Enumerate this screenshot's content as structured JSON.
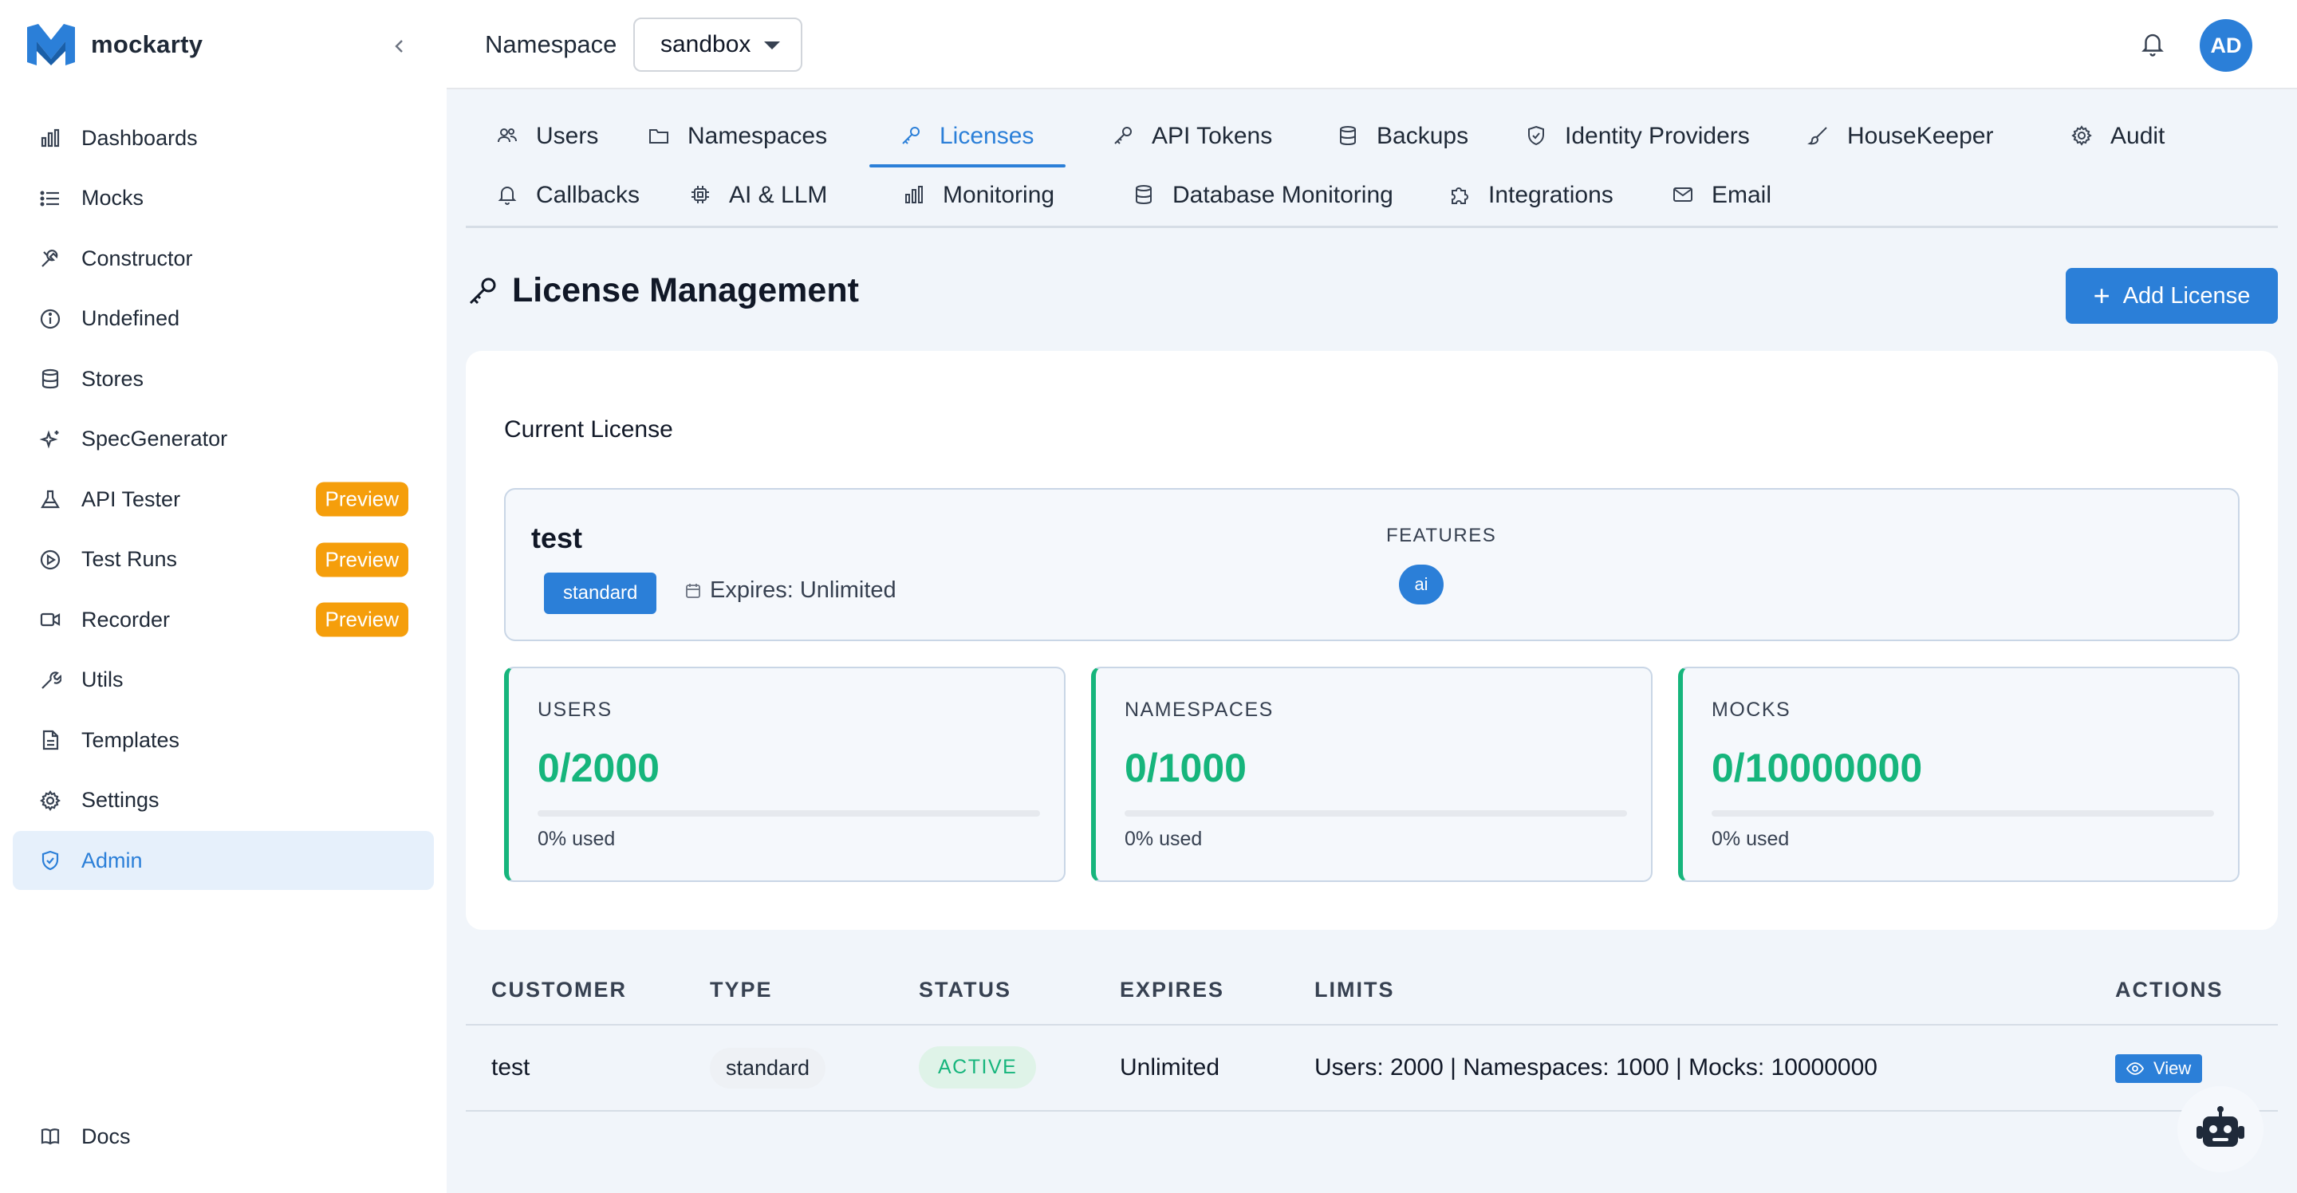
{
  "app": {
    "name": "mockarty",
    "brand_color": "#2b7fd8",
    "accent_green": "#16b57c",
    "preview_color": "#f59e0b"
  },
  "sidebar": {
    "items": [
      {
        "label": "Dashboards",
        "icon": "bar-chart-icon"
      },
      {
        "label": "Mocks",
        "icon": "list-icon"
      },
      {
        "label": "Constructor",
        "icon": "tools-icon"
      },
      {
        "label": "Undefined",
        "icon": "info-icon"
      },
      {
        "label": "Stores",
        "icon": "database-icon"
      },
      {
        "label": "SpecGenerator",
        "icon": "sparkles-icon"
      },
      {
        "label": "API Tester",
        "icon": "flask-icon",
        "badge": "Preview"
      },
      {
        "label": "Test Runs",
        "icon": "play-circle-icon",
        "badge": "Preview"
      },
      {
        "label": "Recorder",
        "icon": "video-icon",
        "badge": "Preview"
      },
      {
        "label": "Utils",
        "icon": "wrench-icon"
      },
      {
        "label": "Templates",
        "icon": "file-icon"
      },
      {
        "label": "Settings",
        "icon": "gear-icon"
      },
      {
        "label": "Admin",
        "icon": "shield-icon",
        "active": true
      }
    ],
    "docs_label": "Docs"
  },
  "header": {
    "namespace_label": "Namespace",
    "namespace_value": "sandbox",
    "avatar_initials": "AD"
  },
  "tabs": [
    {
      "label": "Users",
      "icon": "users-icon"
    },
    {
      "label": "Namespaces",
      "icon": "folder-icon"
    },
    {
      "label": "Licenses",
      "icon": "key-icon",
      "active": true
    },
    {
      "label": "API Tokens",
      "icon": "key-icon"
    },
    {
      "label": "Backups",
      "icon": "database-icon"
    },
    {
      "label": "Identity Providers",
      "icon": "shield-icon"
    },
    {
      "label": "HouseKeeper",
      "icon": "brush-icon"
    },
    {
      "label": "Audit",
      "icon": "gear-icon"
    },
    {
      "label": "Callbacks",
      "icon": "bell-icon"
    },
    {
      "label": "AI & LLM",
      "icon": "cpu-icon"
    },
    {
      "label": "Monitoring",
      "icon": "bar-chart-icon"
    },
    {
      "label": "Database Monitoring",
      "icon": "database-icon"
    },
    {
      "label": "Integrations",
      "icon": "puzzle-icon"
    },
    {
      "label": "Email",
      "icon": "mail-icon"
    }
  ],
  "page": {
    "title": "License Management",
    "add_button": "Add License"
  },
  "current_license": {
    "section_title": "Current License",
    "name": "test",
    "type": "standard",
    "expires": "Expires: Unlimited",
    "features_label": "FEATURES",
    "features": [
      "ai"
    ]
  },
  "stats": [
    {
      "label": "USERS",
      "value": "0/2000",
      "used": "0% used",
      "fraction": 0
    },
    {
      "label": "NAMESPACES",
      "value": "0/1000",
      "used": "0% used",
      "fraction": 0
    },
    {
      "label": "MOCKS",
      "value": "0/10000000",
      "used": "0% used",
      "fraction": 0
    }
  ],
  "table": {
    "headers": [
      "CUSTOMER",
      "TYPE",
      "STATUS",
      "EXPIRES",
      "LIMITS",
      "ACTIONS"
    ],
    "rows": [
      {
        "customer": "test",
        "type": "standard",
        "status": "ACTIVE",
        "expires": "Unlimited",
        "limits": "Users: 2000 | Namespaces: 1000 | Mocks: 10000000",
        "action": "View"
      }
    ]
  }
}
